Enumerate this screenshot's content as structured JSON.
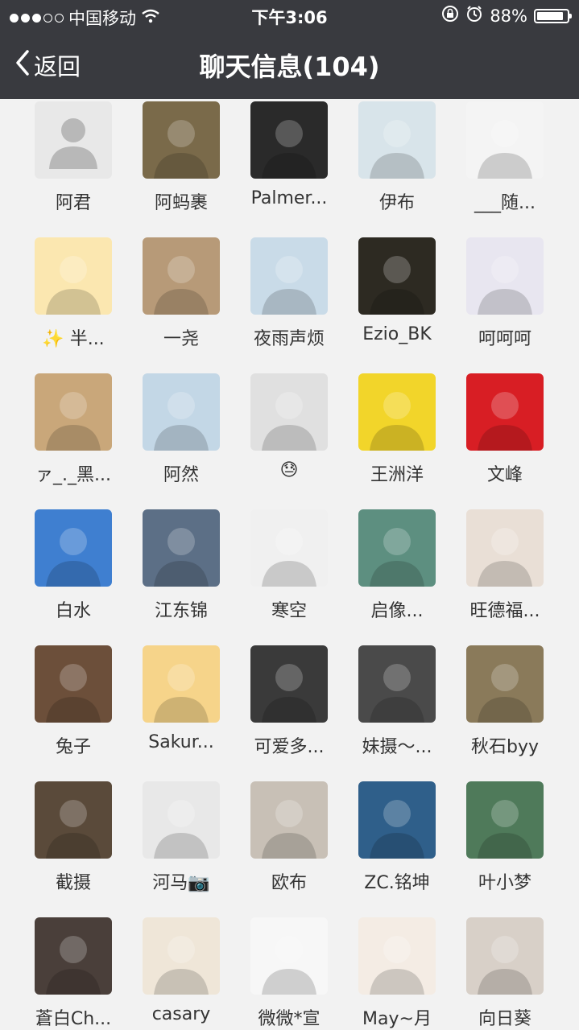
{
  "status_bar": {
    "carrier": "中国移动",
    "time": "下午3:06",
    "battery": "88%",
    "battery_level": 0.88,
    "icons": [
      "signal-dots",
      "wifi-icon",
      "rotation-lock-icon",
      "alarm-icon",
      "battery-icon"
    ]
  },
  "nav": {
    "back_label": "返回",
    "title": "聊天信息(104)"
  },
  "members": [
    {
      "name": "阿君",
      "avatar_color": "#e8e8e8"
    },
    {
      "name": "阿蚂裹",
      "avatar_color": "#7a6a4a"
    },
    {
      "name": "Palmer...",
      "avatar_color": "#2a2a2a"
    },
    {
      "name": "伊布",
      "avatar_color": "#d8e4ea"
    },
    {
      "name": "___随...",
      "avatar_color": "#f4f4f4"
    },
    {
      "name": "✨ 半...",
      "avatar_color": "#fbe7b0"
    },
    {
      "name": "一尧",
      "avatar_color": "#b79a78"
    },
    {
      "name": "夜雨声烦",
      "avatar_color": "#c9dbe8"
    },
    {
      "name": "Ezio_BK",
      "avatar_color": "#2d2a22"
    },
    {
      "name": "呵呵呵",
      "avatar_color": "#e8e6f0"
    },
    {
      "name": "ァ_._黑...",
      "avatar_color": "#c9a77a"
    },
    {
      "name": "阿然",
      "avatar_color": "#c3d7e6"
    },
    {
      "name": "😓",
      "avatar_color": "#e0e0e0"
    },
    {
      "name": "王洲洋",
      "avatar_color": "#f2d52a"
    },
    {
      "name": "文峰",
      "avatar_color": "#d81e24"
    },
    {
      "name": "白水",
      "avatar_color": "#3f7fd0"
    },
    {
      "name": "江东锦",
      "avatar_color": "#5c6f86"
    },
    {
      "name": "寒空",
      "avatar_color": "#f0f0f0"
    },
    {
      "name": "启像...",
      "avatar_color": "#5d8f80"
    },
    {
      "name": "旺德福...",
      "avatar_color": "#e9dfd6"
    },
    {
      "name": "兔子",
      "avatar_color": "#6c4f3a"
    },
    {
      "name": "Sakur...",
      "avatar_color": "#f6d48a"
    },
    {
      "name": "可爱多...",
      "avatar_color": "#3a3a3a"
    },
    {
      "name": "妹摄～...",
      "avatar_color": "#4a4a4a"
    },
    {
      "name": "秋石byy",
      "avatar_color": "#8a7a5a"
    },
    {
      "name": "截摄",
      "avatar_color": "#5a4a3a"
    },
    {
      "name": "河马📷",
      "avatar_color": "#e8e8e8"
    },
    {
      "name": "欧布",
      "avatar_color": "#c8c0b6"
    },
    {
      "name": "ZC.铭坤",
      "avatar_color": "#2f5f8a"
    },
    {
      "name": "叶小梦",
      "avatar_color": "#4f7a5a"
    },
    {
      "name": "蒼白Ch...",
      "avatar_color": "#4a3f3a"
    },
    {
      "name": "casary",
      "avatar_color": "#efe6d8"
    },
    {
      "name": "微微*宣",
      "avatar_color": "#f7f7f7"
    },
    {
      "name": "May~月",
      "avatar_color": "#f4ece4"
    },
    {
      "name": "向日葵",
      "avatar_color": "#d8d0c8"
    }
  ]
}
